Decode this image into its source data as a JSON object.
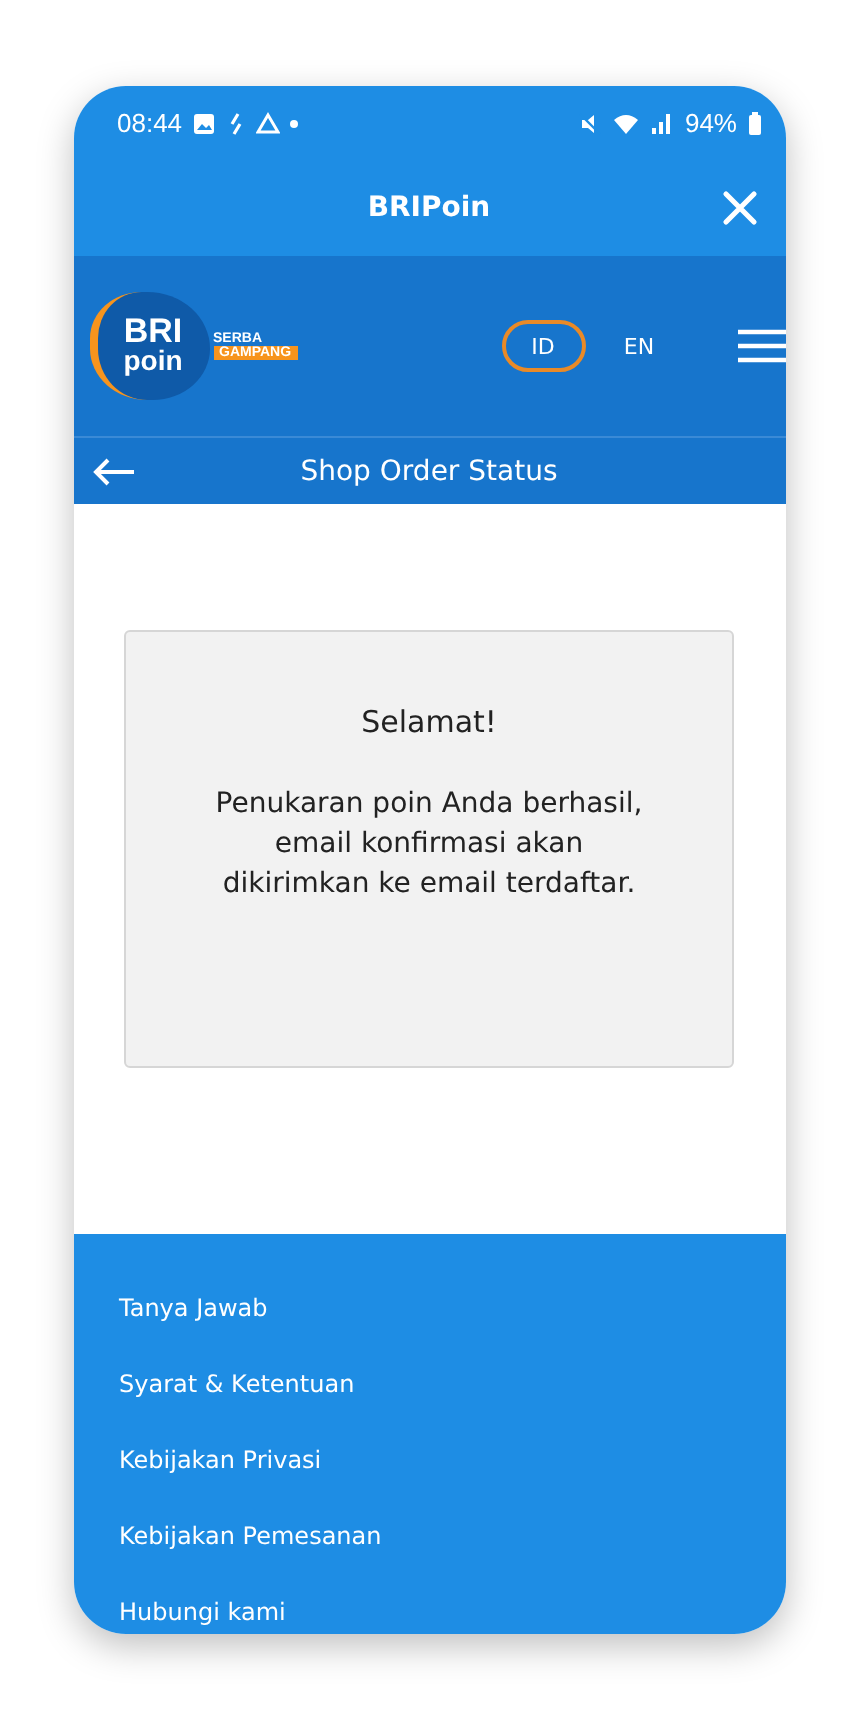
{
  "status_bar": {
    "time": "08:44",
    "battery": "94%"
  },
  "app_bar": {
    "title": "BRIPoin"
  },
  "header": {
    "logo": {
      "line_1": "BRI",
      "line_2": "poin",
      "tagline_1": "SERBA",
      "tagline_2": "GAMPANG"
    },
    "languages": [
      {
        "label": "ID",
        "selected": true
      },
      {
        "label": "EN",
        "selected": false
      }
    ]
  },
  "page_title": "Shop Order Status",
  "message": {
    "title": "Selamat!",
    "body": "Penukaran poin Anda berhasil, email konfirmasi akan dikirimkan ke email terdaftar."
  },
  "footer": {
    "links": [
      "Tanya Jawab",
      "Syarat & Ketentuan",
      "Kebijakan Privasi",
      "Kebijakan Pemesanan",
      "Hubungi kami"
    ]
  }
}
